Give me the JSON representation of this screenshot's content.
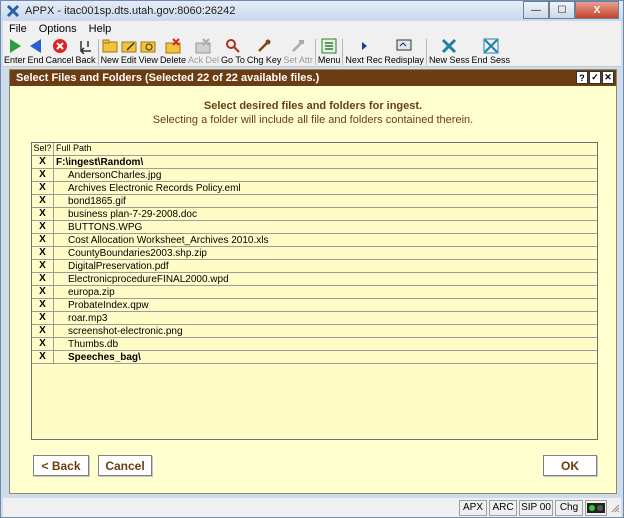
{
  "window": {
    "title": "APPX - itac001sp.dts.utah.gov:8060:26242",
    "minimize": "—",
    "maximize": "☐",
    "close": "X"
  },
  "menu": [
    "File",
    "Options",
    "Help"
  ],
  "toolbar": [
    {
      "label": "Enter",
      "icon": "enter-icon",
      "enabled": true
    },
    {
      "label": "End",
      "icon": "end-icon",
      "enabled": true
    },
    {
      "label": "Cancel",
      "icon": "cancel-icon",
      "enabled": true
    },
    {
      "label": "Back",
      "icon": "back-icon",
      "enabled": true
    },
    {
      "label": "New",
      "icon": "new-folder-icon",
      "enabled": true
    },
    {
      "label": "Edit",
      "icon": "edit-folder-icon",
      "enabled": true
    },
    {
      "label": "View",
      "icon": "view-folder-icon",
      "enabled": true
    },
    {
      "label": "Delete",
      "icon": "delete-folder-icon",
      "enabled": true
    },
    {
      "label": "Ack Del",
      "icon": "ack-del-icon",
      "enabled": false
    },
    {
      "label": "Go To",
      "icon": "magnifier-icon",
      "enabled": true
    },
    {
      "label": "Chg Key",
      "icon": "key-icon",
      "enabled": true
    },
    {
      "label": "Set Attr",
      "icon": "set-attr-icon",
      "enabled": false
    },
    {
      "label": "Menu",
      "icon": "menu-icon",
      "enabled": true
    },
    {
      "label": "Next Rec",
      "icon": "next-rec-icon",
      "enabled": true
    },
    {
      "label": "Redisplay",
      "icon": "redisplay-icon",
      "enabled": true
    },
    {
      "label": "New Sess",
      "icon": "new-session-icon",
      "enabled": true
    },
    {
      "label": "End Sess",
      "icon": "end-session-icon",
      "enabled": true
    }
  ],
  "panel": {
    "title": "Select Files and Folders (Selected 22 of 22 available files.)",
    "header_buttons": [
      "?",
      "✓",
      "✕"
    ],
    "instruction_bold": "Select desired files and folders for ingest.",
    "instruction": "Selecting a folder will include all file and folders contained therein."
  },
  "grid": {
    "col_sel": "Sel?",
    "col_path": "Full Path",
    "rows": [
      {
        "sel": "X",
        "path": "F:\\ingest\\Random\\",
        "folder": true,
        "indent": false
      },
      {
        "sel": "X",
        "path": "AndersonCharles.jpg",
        "folder": false,
        "indent": true
      },
      {
        "sel": "X",
        "path": "Archives Electronic Records Policy.eml",
        "folder": false,
        "indent": true
      },
      {
        "sel": "X",
        "path": "bond1865.gif",
        "folder": false,
        "indent": true
      },
      {
        "sel": "X",
        "path": "business plan-7-29-2008.doc",
        "folder": false,
        "indent": true
      },
      {
        "sel": "X",
        "path": "BUTTONS.WPG",
        "folder": false,
        "indent": true
      },
      {
        "sel": "X",
        "path": "Cost Allocation Worksheet_Archives 2010.xls",
        "folder": false,
        "indent": true
      },
      {
        "sel": "X",
        "path": "CountyBoundaries2003.shp.zip",
        "folder": false,
        "indent": true
      },
      {
        "sel": "X",
        "path": "DigitalPreservation.pdf",
        "folder": false,
        "indent": true
      },
      {
        "sel": "X",
        "path": "ElectronicprocedureFINAL2000.wpd",
        "folder": false,
        "indent": true
      },
      {
        "sel": "X",
        "path": "europa.zip",
        "folder": false,
        "indent": true
      },
      {
        "sel": "X",
        "path": "ProbateIndex.qpw",
        "folder": false,
        "indent": true
      },
      {
        "sel": "X",
        "path": "roar.mp3",
        "folder": false,
        "indent": true
      },
      {
        "sel": "X",
        "path": "screenshot-electronic.png",
        "folder": false,
        "indent": true
      },
      {
        "sel": "X",
        "path": "Thumbs.db",
        "folder": false,
        "indent": true
      },
      {
        "sel": "X",
        "path": "Speeches_bag\\",
        "folder": true,
        "indent": true
      }
    ]
  },
  "buttons": {
    "back": "< Back",
    "cancel": "Cancel",
    "ok": "OK"
  },
  "status": {
    "apx": "APX",
    "arc": "ARC",
    "sip": "SIP 00",
    "chg": "Chg"
  },
  "colors": {
    "accent": "#6c3d12",
    "panel_bg": "#ffffd0",
    "grid_bg": "#fffcc8"
  }
}
